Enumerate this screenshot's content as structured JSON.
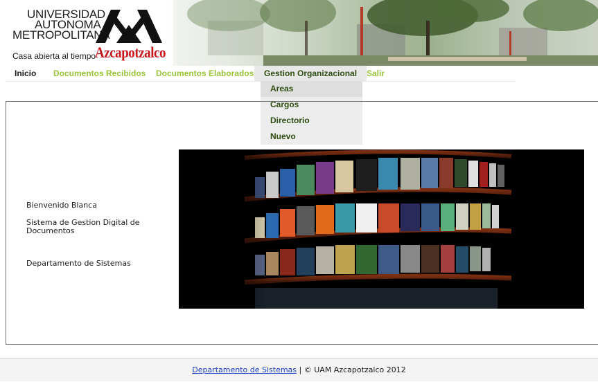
{
  "header": {
    "logo_line1": "UNIVERSIDAD",
    "logo_line2": "AUTONOMA",
    "logo_line3": "METROPOLITANA",
    "logo_tagline": "Casa abierta al tiempo",
    "logo_campus": "Azcapotzalco"
  },
  "menu": {
    "items": [
      {
        "label": "Inicio"
      },
      {
        "label": "Documentos Recibidos"
      },
      {
        "label": "Documentos Elaborados"
      },
      {
        "label": "Gestion Organizacional"
      },
      {
        "label": "Salir"
      }
    ],
    "dropdown": [
      {
        "label": "Areas"
      },
      {
        "label": "Cargos"
      },
      {
        "label": "Directorio"
      },
      {
        "label": "Nuevo"
      }
    ]
  },
  "content": {
    "welcome": "Bienvenido Blanca",
    "system_name": "Sistema de Gestion Digital de Documentos",
    "department": "Departamento de Sistemas"
  },
  "footer": {
    "link": "Departamento de Sistemas",
    "copyright": " | © UAM Azcapotzalco 2012"
  },
  "colors": {
    "menu_link": "#9ac43b",
    "menu_active_text": "#2e4d12",
    "logo_red": "#c8161d",
    "footer_link": "#1a3ec4"
  },
  "icons": [
    "uam-logo-mark",
    "bookshelf-photo",
    "campus-photo"
  ]
}
